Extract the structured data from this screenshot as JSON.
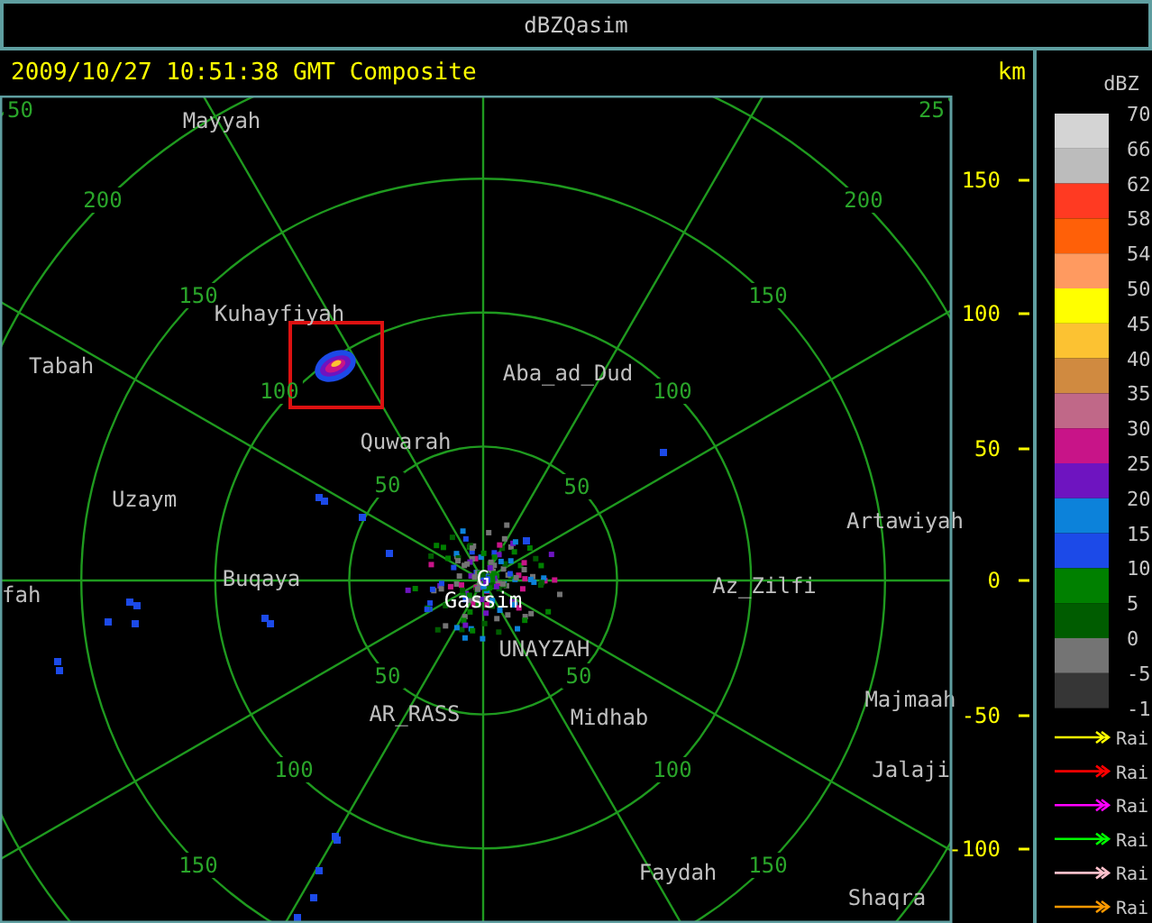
{
  "window": {
    "title": "dBZQasim"
  },
  "header": {
    "timestamp": "2009/10/27 10:51:38 GMT Composite",
    "unit": "km"
  },
  "map": {
    "range_labels": [
      "50",
      "25",
      "200",
      "200",
      "150",
      "150",
      "100",
      "100",
      "50",
      "50",
      "50",
      "50",
      "100",
      "100",
      "150",
      "150"
    ],
    "places": [
      {
        "name": "Mayyah",
        "kind": "town"
      },
      {
        "name": "Kuhayfiyah",
        "kind": "town"
      },
      {
        "name": "Tabah",
        "kind": "town"
      },
      {
        "name": "Aba_ad_Dud",
        "kind": "town"
      },
      {
        "name": "Quwarah",
        "kind": "town"
      },
      {
        "name": "Uzaym",
        "kind": "town"
      },
      {
        "name": "Artawiyah",
        "kind": "town"
      },
      {
        "name": "fah",
        "kind": "town"
      },
      {
        "name": "Buqaya",
        "kind": "town"
      },
      {
        "name": "G",
        "kind": "radar"
      },
      {
        "name": "Az_Zilfi",
        "kind": "town"
      },
      {
        "name": "Gassim",
        "kind": "radar"
      },
      {
        "name": "UNAYZAH",
        "kind": "town"
      },
      {
        "name": "AR_RASS",
        "kind": "town"
      },
      {
        "name": "Midhab",
        "kind": "town"
      },
      {
        "name": "Majmaah",
        "kind": "town"
      },
      {
        "name": "Jalaji",
        "kind": "town"
      },
      {
        "name": "Faydah",
        "kind": "town"
      },
      {
        "name": "Shaqra",
        "kind": "town"
      }
    ],
    "y_axis_labels": [
      "150",
      "100",
      "50",
      "0",
      "-50",
      "-100"
    ]
  },
  "legend": {
    "title": "dBZ",
    "scale_labels": [
      "70",
      "66",
      "62",
      "58",
      "54",
      "50",
      "45",
      "40",
      "35",
      "30",
      "25",
      "20",
      "15",
      "10",
      "5",
      "0",
      "-5",
      "-1"
    ],
    "bins": [
      {
        "color": "#d4d4d4"
      },
      {
        "color": "#bcbcbc"
      },
      {
        "color": "#ff3a22"
      },
      {
        "color": "#ff6008"
      },
      {
        "color": "#ff9a60"
      },
      {
        "color": "#ffff00"
      },
      {
        "color": "#fcc232"
      },
      {
        "color": "#d08a40"
      },
      {
        "color": "#c06888"
      },
      {
        "color": "#c81488"
      },
      {
        "color": "#6e14c0"
      },
      {
        "color": "#0c82da"
      },
      {
        "color": "#1c4ae8"
      },
      {
        "color": "#008000"
      },
      {
        "color": "#005c00"
      },
      {
        "color": "#747474"
      },
      {
        "color": "#363636"
      }
    ],
    "tracks": [
      {
        "label": "Rai",
        "color": "#ffff00"
      },
      {
        "label": "Rai",
        "color": "#ff0000"
      },
      {
        "label": "Rai",
        "color": "#ff00ff"
      },
      {
        "label": "Rai",
        "color": "#00ff00"
      },
      {
        "label": "Rai",
        "color": "#ffc0cb"
      },
      {
        "label": "Rai",
        "color": "#ff9900"
      }
    ]
  }
}
